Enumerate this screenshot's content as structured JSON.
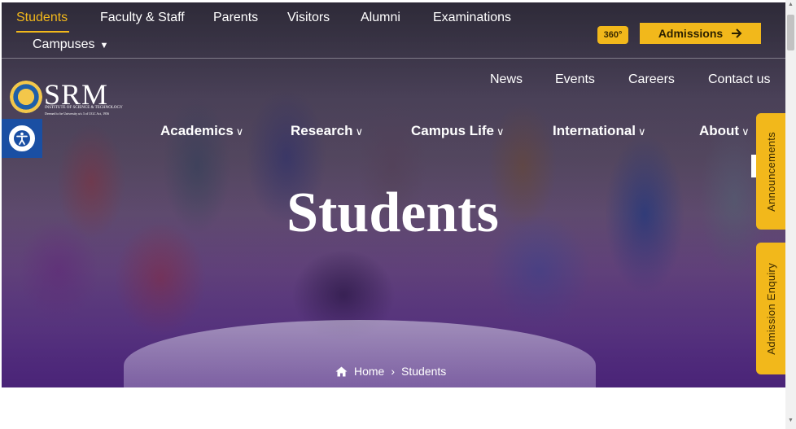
{
  "topnav": {
    "items": [
      "Students",
      "Faculty & Staff",
      "Parents",
      "Visitors",
      "Alumni",
      "Examinations"
    ],
    "campuses_label": "Campuses",
    "badge_360": "360°",
    "admissions_label": "Admissions"
  },
  "secnav": {
    "items": [
      "News",
      "Events",
      "Careers",
      "Contact us"
    ]
  },
  "logo": {
    "wordmark": "SRM",
    "line1": "INSTITUTE OF SCIENCE & TECHNOLOGY",
    "line2": "Deemed to be University u/s 3 of UGC Act, 1956"
  },
  "mainmenu": {
    "items": [
      "Academics",
      "Research",
      "Campus Life",
      "International",
      "About"
    ]
  },
  "hero": {
    "title": "Students"
  },
  "breadcrumb": {
    "home": "Home",
    "separator": "›",
    "current": "Students"
  },
  "side_tabs": {
    "announcements": "Announcements",
    "admission_enquiry": "Admission Enquiry"
  },
  "colors": {
    "accent": "#f2b81b",
    "accessibility_blue": "#1a4fa3"
  },
  "icons": {
    "arrow": "arrow-right-icon",
    "home": "home-icon",
    "accessibility": "accessibility-icon"
  }
}
